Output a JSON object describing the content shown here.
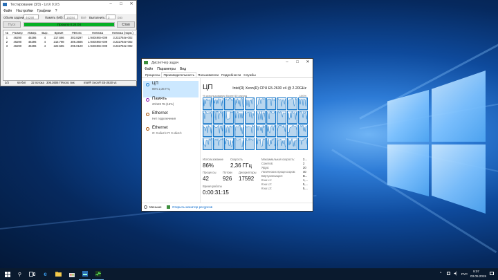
{
  "linx": {
    "title": "Тестирование (3/3) - LinX 0.9.5",
    "menu": [
      "Файл",
      "Настройки",
      "Графики",
      "?"
    ],
    "problem_size_label": "Объём задачи:",
    "problem_size": "46290",
    "memory_label": "Память (Мб):",
    "memory": "16384",
    "memory_all": "Всё",
    "runs_label": "Выполнить:",
    "runs": "3",
    "runs_unit": "раз",
    "start_label": "Пуск",
    "progress_label": "Прошло 0:24:04",
    "progress": 1.0,
    "stop_label": "Стоп",
    "columns": [
      "№",
      "Размер",
      "Измер.",
      "Выр.",
      "Время",
      "ГФлопс",
      "Невязка",
      "Невязка (норм.)"
    ],
    "rows": [
      [
        "1",
        "46290",
        "46296",
        "4",
        "217.666",
        "303.8297",
        "1.940490e-009",
        "3.232784e-002"
      ],
      [
        "2",
        "46290",
        "46296",
        "4",
        "215.798",
        "306.3606",
        "1.940490e-009",
        "3.232784e-002"
      ],
      [
        "3",
        "46290",
        "46296",
        "4",
        "222.555",
        "295.0120",
        "1.940490e-009",
        "3.232784e-002"
      ]
    ],
    "status": [
      "3/3",
      "64-бит",
      "32 потока",
      "306.3606 ГФлопс пик",
      "Intel® Xeon® E5-2630 v4"
    ]
  },
  "taskmgr": {
    "title": "Диспетчер задач",
    "menu": [
      "Файл",
      "Параметры",
      "Вид"
    ],
    "tabs": [
      "Процессы",
      "Производительность",
      "Пользователи",
      "Подробности",
      "Службы"
    ],
    "active_tab": 1,
    "sidebar": [
      {
        "name": "ЦП",
        "sub": "86% 2,36 ГГц",
        "color": "#1979ca"
      },
      {
        "name": "Память",
        "sub": "20/128 ГБ (16%)",
        "color": "#8b12ae"
      },
      {
        "name": "Ethernet",
        "sub": "Нет подключения",
        "color": "#a74f01"
      },
      {
        "name": "Ethernet",
        "sub": "О: 0 кбит/с П: 0 кбит/с",
        "color": "#a74f01"
      }
    ],
    "heading": "ЦП",
    "cpu_name": "Intel(R) Xeon(R) CPU E5-2630 v4 @ 2.20GHz",
    "graph_caption": "% использования более 60 секунд",
    "graph_max": "100%",
    "graph_rows": 4,
    "graph_cols": 10,
    "stats": {
      "usage_label": "Использование",
      "usage": "86%",
      "speed_label": "Скорость",
      "speed": "2,36 ГГц",
      "processes_label": "Процессы",
      "processes": "42",
      "threads_label": "Потоки",
      "threads": "926",
      "handles_label": "Дескрипторы",
      "handles": "17592",
      "uptime_label": "Время работы",
      "uptime": "0:00:31:15"
    },
    "right": [
      {
        "label": "Максимальная скорость:",
        "value": "2..."
      },
      {
        "label": "Сокетов:",
        "value": "2"
      },
      {
        "label": "Ядра:",
        "value": "20"
      },
      {
        "label": "Логических процессоров:",
        "value": "40"
      },
      {
        "label": "Виртуализация:",
        "value": "В..."
      },
      {
        "label": "Кэш L1:",
        "value": "1,..."
      },
      {
        "label": "Кэш L2:",
        "value": "5,..."
      },
      {
        "label": "Кэш L3:",
        "value": "5,..."
      }
    ],
    "less_label": "Меньше",
    "monitor_link": "Открыть монитор ресурсов"
  },
  "taskbar": {
    "lang": "РУС",
    "time": "9:07",
    "date": "03.05.2019",
    "icons": [
      "start-icon",
      "search-icon",
      "task-view-icon",
      "edge-icon",
      "explorer-icon",
      "store-icon",
      "linx-icon",
      "taskmgr-icon"
    ]
  },
  "colors": {
    "accent": "#1979ca",
    "progress": "#06b025",
    "link": "#0066cc"
  }
}
